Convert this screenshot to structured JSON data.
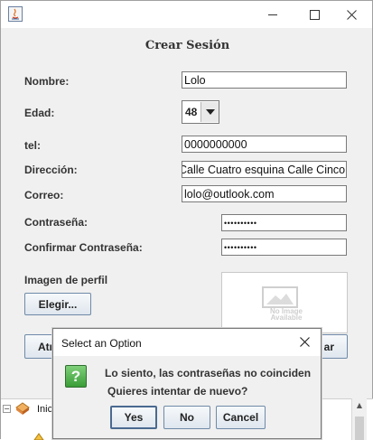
{
  "window": {
    "icon": "java-app-icon",
    "controls": {
      "minimize": "minimize-icon",
      "maximize": "maximize-icon",
      "close": "close-icon"
    }
  },
  "form": {
    "title": "Crear Sesión",
    "nombre_label": "Nombre:",
    "nombre_value": "Lolo",
    "edad_label": "Edad:",
    "edad_value": "48",
    "tel_label": "tel:",
    "tel_value": "0000000000",
    "direccion_label": "Dirección:",
    "direccion_value": "Calle Cuatro esquina Calle Cinco",
    "correo_label": "Correo:",
    "correo_value": "lolo@outlook.com",
    "contrasena_label": "Contraseña:",
    "contrasena_value": "••••••••••",
    "confirmar_label": "Confirmar Contraseña:",
    "confirmar_value": "••••••••••",
    "imagen_label": "Imagen de perfil",
    "elegir_label": "Elegir...",
    "no_image_text": [
      "No Image",
      "Available"
    ],
    "back_button_partial": "Atr",
    "right_button_partial": "ar"
  },
  "tree": {
    "root_label": "Inici"
  },
  "dialog": {
    "title": "Select an Option",
    "message_line1": "Lo siento, las contraseñas no coinciden",
    "message_line2": "Quieres intentar de nuevo?",
    "icon": "question-icon",
    "yes_label": "Yes",
    "no_label": "No",
    "cancel_label": "Cancel"
  },
  "colors": {
    "window_bg": "#f0f0f0",
    "button_border": "#6f8aa8",
    "question_icon": "#3a9d37"
  }
}
